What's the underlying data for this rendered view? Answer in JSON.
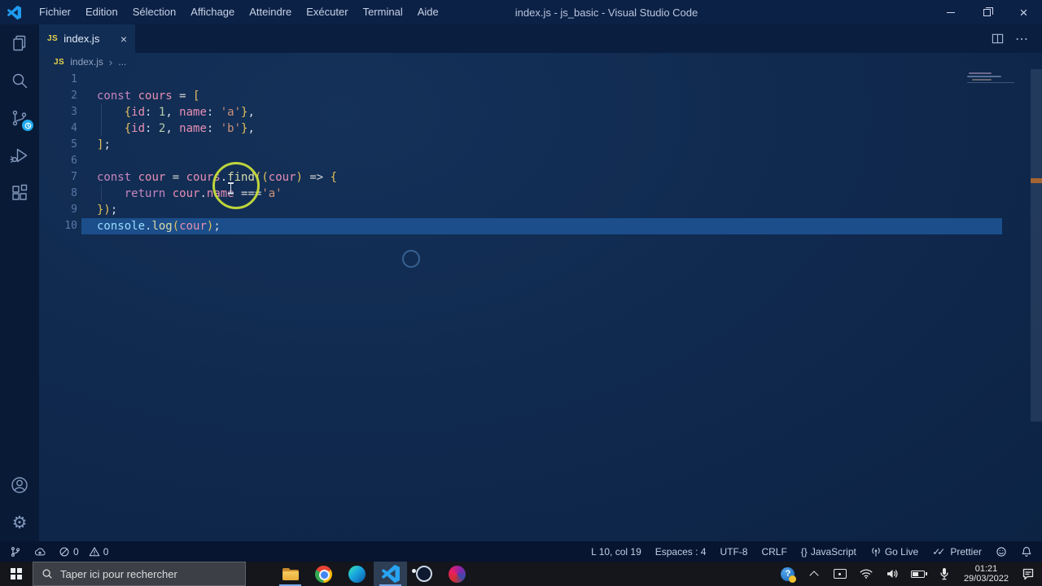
{
  "colors": {
    "tokens": {
      "kw": "#c586c0",
      "plain": "#d6dce8",
      "var": "#e78fb3",
      "op": "#d4d4d4",
      "brk": "#e2c05c",
      "num": "#b5cea8",
      "str": "#ce9178",
      "fn": "#dcdcaa",
      "obj": "#9cdcfe"
    },
    "current_line": "#1b4e8a",
    "click_ring": "#c7dd3a",
    "accent": "#2d7ad6"
  },
  "icons": {
    "close": "×",
    "more": "⋯",
    "chevron": "›",
    "js_badge": "JS",
    "gear": "⚙",
    "check_double": "✓✓",
    "question": "?"
  },
  "window": {
    "title": "index.js - js_basic - Visual Studio Code"
  },
  "menu": {
    "items": [
      "Fichier",
      "Edition",
      "Sélection",
      "Affichage",
      "Atteindre",
      "Exécuter",
      "Terminal",
      "Aide"
    ]
  },
  "tab": {
    "label": "index.js"
  },
  "breadcrumb": {
    "file": "index.js",
    "more": "..."
  },
  "editor": {
    "lines": [
      {
        "n": "1",
        "tokens": []
      },
      {
        "n": "2",
        "tokens": [
          [
            "kw",
            "const"
          ],
          [
            "plain",
            " "
          ],
          [
            "var",
            "cours"
          ],
          [
            "op",
            " = "
          ],
          [
            "brk",
            "["
          ]
        ]
      },
      {
        "n": "3",
        "tokens": [
          [
            "plain",
            "    "
          ],
          [
            "brk",
            "{"
          ],
          [
            "var",
            "id"
          ],
          [
            "plain",
            ": "
          ],
          [
            "num",
            "1"
          ],
          [
            "plain",
            ", "
          ],
          [
            "var",
            "name"
          ],
          [
            "plain",
            ": "
          ],
          [
            "str",
            "'a'"
          ],
          [
            "brk",
            "}"
          ],
          [
            "plain",
            ","
          ]
        ]
      },
      {
        "n": "4",
        "tokens": [
          [
            "plain",
            "    "
          ],
          [
            "brk",
            "{"
          ],
          [
            "var",
            "id"
          ],
          [
            "plain",
            ": "
          ],
          [
            "num",
            "2"
          ],
          [
            "plain",
            ", "
          ],
          [
            "var",
            "name"
          ],
          [
            "plain",
            ": "
          ],
          [
            "str",
            "'b'"
          ],
          [
            "brk",
            "}"
          ],
          [
            "plain",
            ","
          ]
        ]
      },
      {
        "n": "5",
        "tokens": [
          [
            "brk",
            "]"
          ],
          [
            "plain",
            ";"
          ]
        ]
      },
      {
        "n": "6",
        "tokens": []
      },
      {
        "n": "7",
        "tokens": [
          [
            "kw",
            "const"
          ],
          [
            "plain",
            " "
          ],
          [
            "var",
            "cour"
          ],
          [
            "op",
            " = "
          ],
          [
            "var",
            "cours"
          ],
          [
            "plain",
            "."
          ],
          [
            "fn",
            "find"
          ],
          [
            "brk",
            "(("
          ],
          [
            "var",
            "cour"
          ],
          [
            "brk",
            ")"
          ],
          [
            "op",
            " => "
          ],
          [
            "brk",
            "{"
          ]
        ]
      },
      {
        "n": "8",
        "tokens": [
          [
            "plain",
            "    "
          ],
          [
            "kw",
            "return"
          ],
          [
            "plain",
            " "
          ],
          [
            "var",
            "cour"
          ],
          [
            "plain",
            "."
          ],
          [
            "var",
            "name"
          ],
          [
            "op",
            " ==="
          ],
          [
            "str",
            "'a'"
          ]
        ]
      },
      {
        "n": "9",
        "tokens": [
          [
            "brk",
            "})"
          ],
          [
            "plain",
            ";"
          ]
        ]
      },
      {
        "n": "10",
        "hl": true,
        "tokens": [
          [
            "obj",
            "console"
          ],
          [
            "plain",
            "."
          ],
          [
            "fn",
            "log"
          ],
          [
            "brk",
            "("
          ],
          [
            "var",
            "cour"
          ],
          [
            "brk",
            ")"
          ],
          [
            "plain",
            ";"
          ]
        ]
      }
    ]
  },
  "status_bar": {
    "errors": "0",
    "warnings": "0",
    "cursor": "L 10, col 19",
    "indent": "Espaces : 4",
    "encoding": "UTF-8",
    "eol": "CRLF",
    "language_icon": "{}",
    "language": "JavaScript",
    "go_live": "Go Live",
    "prettier": "Prettier"
  },
  "taskbar": {
    "search_placeholder": "Taper ici pour rechercher",
    "time": "01:21",
    "date": "29/03/2022"
  }
}
